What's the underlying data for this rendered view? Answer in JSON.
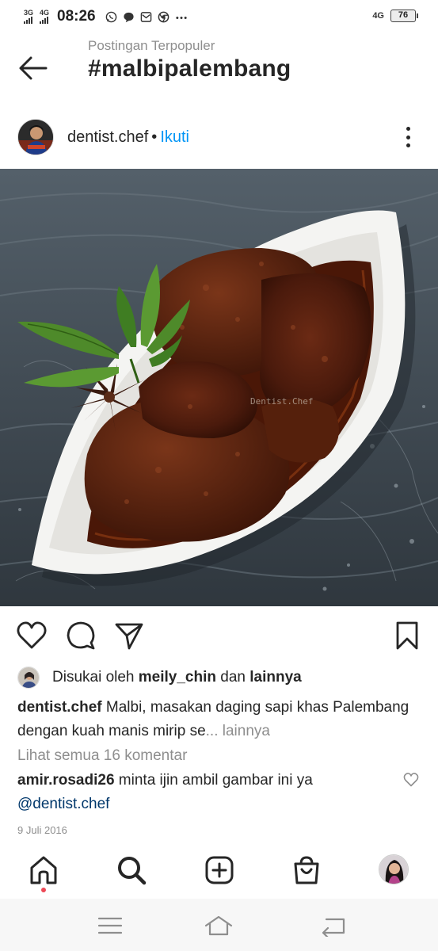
{
  "status_bar": {
    "net1": "3G",
    "net2": "4G",
    "time": "08:26",
    "notif_icons": [
      "whatsapp-icon",
      "chat-bubble-icon",
      "mail-icon",
      "chrome-icon",
      "more-dots-icon"
    ],
    "net_right": "4G",
    "battery": "76"
  },
  "header": {
    "subtitle": "Postingan Terpopuler",
    "title": "#malbipalembang"
  },
  "post": {
    "username": "dentist.chef",
    "separator": "•",
    "follow": "Ikuti",
    "image_watermark": "Dentist.Chef",
    "liked_by_prefix": "Disukai oleh ",
    "liked_by_user": "meily_chin",
    "liked_by_middle": " dan ",
    "liked_by_others": "lainnya",
    "caption_user": "dentist.chef",
    "caption_text": " Malbi, masakan daging sapi khas Palembang dengan kuah manis mirip se",
    "caption_ellipsis": "... ",
    "caption_more": "lainnya",
    "view_comments": "Lihat semua 16 komentar",
    "comment_user": "amir.rosadi26",
    "comment_text": " minta ijin ambil gambar ini ya ",
    "comment_mention": "@dentist.chef",
    "date": "9 Juli 2016"
  },
  "actions": [
    "heart-icon",
    "comment-icon",
    "share-icon",
    "bookmark-icon"
  ],
  "bottom_nav": [
    "home-icon",
    "search-icon",
    "new-post-icon",
    "shop-icon",
    "profile-avatar"
  ],
  "system_nav": [
    "menu-icon",
    "home-outline-icon",
    "back-icon"
  ],
  "colors": {
    "link_blue": "#0095f6",
    "mention_blue": "#00376b",
    "muted": "#8e8e8e",
    "text": "#262626",
    "notification_dot": "#ed4956"
  }
}
